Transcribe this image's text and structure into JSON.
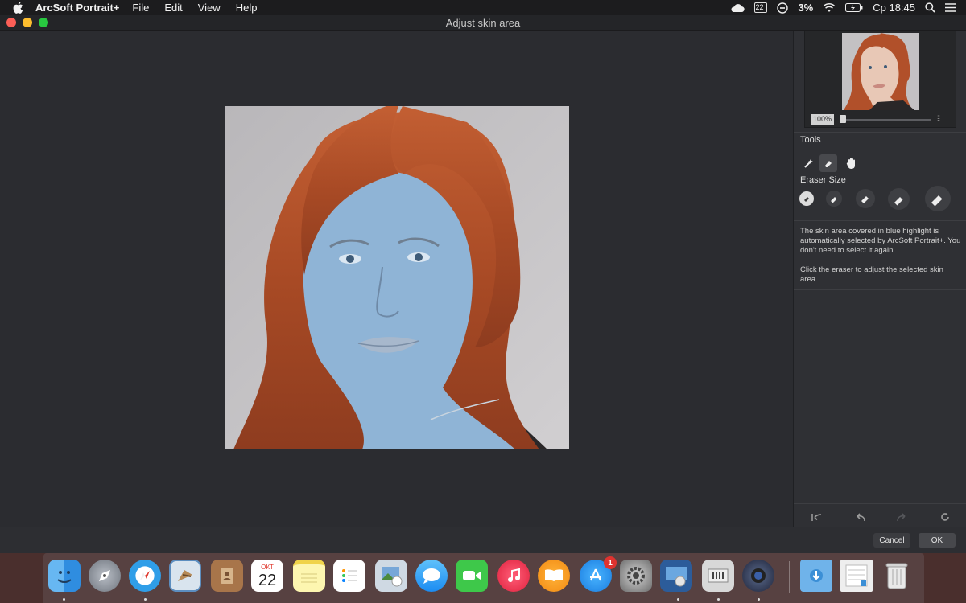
{
  "menubar": {
    "app_name": "ArcSoft Portrait+",
    "items": [
      "File",
      "Edit",
      "View",
      "Help"
    ],
    "calendar_day": "22",
    "battery": "3%",
    "clock": "Ср 18:45"
  },
  "window": {
    "title": "Adjust skin area"
  },
  "navigator": {
    "zoom": "100%",
    "fit_label": "⁞⁞"
  },
  "tools": {
    "section_title": "Tools",
    "eraser_size_title": "Eraser Size",
    "hint_1": "The skin area covered in blue highlight is automatically selected by ArcSoft Portrait+. You don't need to select it again.",
    "hint_2": "Click the eraser to adjust the selected skin area."
  },
  "footer": {
    "cancel_label": "Cancel",
    "ok_label": "OK"
  },
  "dock": {
    "calendar_month": "ОКТ",
    "calendar_day": "22",
    "appstore_badge": "1",
    "icons": [
      "finder-icon",
      "launchpad-icon",
      "safari-icon",
      "mail-icon",
      "contacts-icon",
      "calendar-icon",
      "notes-icon",
      "reminders-icon",
      "photo-icon",
      "messages-icon",
      "facetime-icon",
      "itunes-icon",
      "ibooks-icon",
      "appstore-icon",
      "system-preferences-icon",
      "photo-editor-icon",
      "utility-icon",
      "camera-app-icon",
      "downloads-icon",
      "documents-icon",
      "trash-icon"
    ]
  },
  "colors": {
    "accent": "#0a84ff",
    "skin_highlight": "#8fb4d6",
    "hair": "#b7522b"
  }
}
